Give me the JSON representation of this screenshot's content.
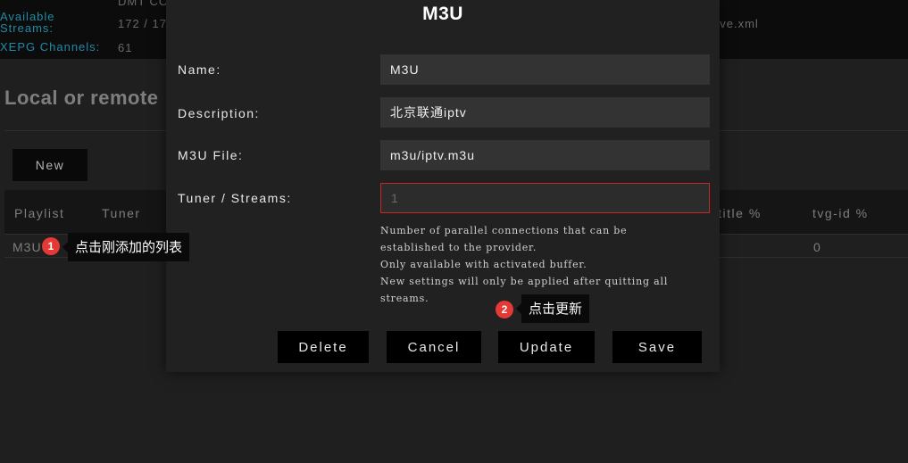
{
  "stats": {
    "available_streams_label": "Available\nStreams:",
    "available_streams_value": "172 / 17",
    "xepg_channels_label": "XEPG Channels:",
    "xepg_channels_value": "61",
    "top_cut_value": "DMT CCT",
    "right_text": "eve.xml"
  },
  "section": {
    "title": "Local or remote",
    "new_button": "New"
  },
  "table": {
    "headers": [
      "Playlist",
      "Tuner",
      "-title %",
      "tvg-id %"
    ],
    "row": {
      "playlist": "M3U",
      "tvg_id": "0"
    }
  },
  "modal": {
    "title": "M3U",
    "name_label": "Name:",
    "name_value": "M3U",
    "description_label": "Description:",
    "description_value": "北京联通iptv",
    "file_label": "M3U File:",
    "file_value": "m3u/iptv.m3u",
    "tuner_label": "Tuner / Streams:",
    "tuner_placeholder": "1",
    "help_lines": [
      "Number of parallel connections that can be",
      "established to the provider.",
      "Only available with activated buffer.",
      "New settings will only be applied after quitting all",
      "streams."
    ],
    "buttons": {
      "delete": "Delete",
      "cancel": "Cancel",
      "update": "Update",
      "save": "Save"
    }
  },
  "annotations": [
    {
      "number": "1",
      "text": "点击刚添加的列表"
    },
    {
      "number": "2",
      "text": "点击更新"
    }
  ],
  "colors": {
    "accent_label": "#2aa8c8",
    "badge": "#e53935",
    "error_border": "#c62828"
  }
}
